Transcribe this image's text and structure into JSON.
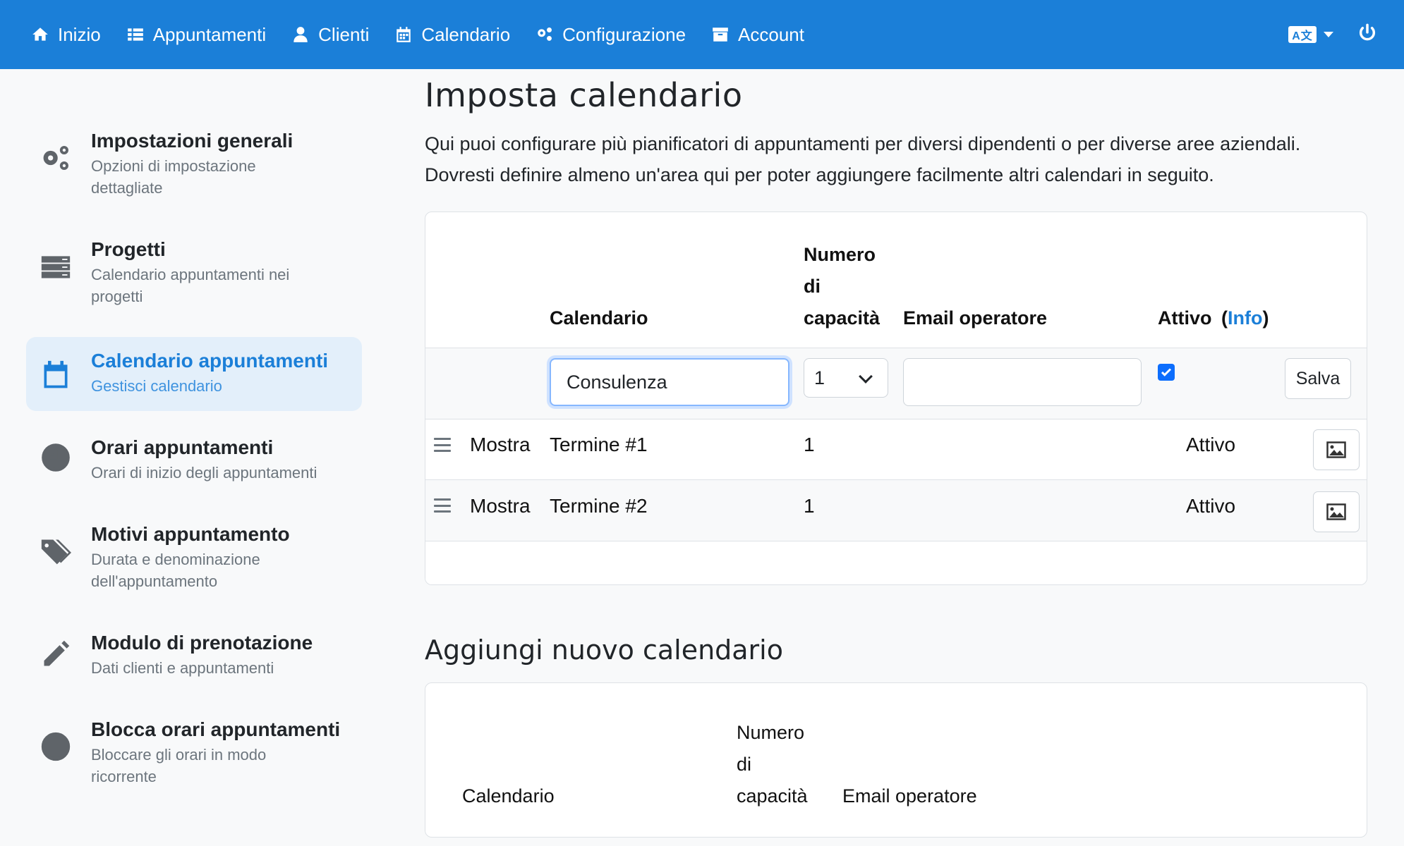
{
  "nav": {
    "items": [
      {
        "label": "Inizio",
        "icon": "home-icon"
      },
      {
        "label": "Appuntamenti",
        "icon": "list-icon"
      },
      {
        "label": "Clienti",
        "icon": "user-icon"
      },
      {
        "label": "Calendario",
        "icon": "calendar-icon"
      },
      {
        "label": "Configurazione",
        "icon": "gears-icon"
      },
      {
        "label": "Account",
        "icon": "archive-icon"
      }
    ],
    "language_icon": "language-icon",
    "power_icon": "power-icon",
    "background_color": "#1b7fd8"
  },
  "sidebar": {
    "items": [
      {
        "title": "Impostazioni generali",
        "subtitle": "Opzioni di impostazione dettagliate",
        "icon": "gears-icon"
      },
      {
        "title": "Progetti",
        "subtitle": "Calendario appuntamenti nei progetti",
        "icon": "server-icon"
      },
      {
        "title": "Calendario appuntamenti",
        "subtitle": "Gestisci calendario",
        "icon": "calendar-icon",
        "active": true
      },
      {
        "title": "Orari appuntamenti",
        "subtitle": "Orari di inizio degli appuntamenti",
        "icon": "clock-icon"
      },
      {
        "title": "Motivi appuntamento",
        "subtitle": "Durata e denominazione dell'appuntamento",
        "icon": "tags-icon"
      },
      {
        "title": "Modulo di prenotazione",
        "subtitle": "Dati clienti e appuntamenti",
        "icon": "pencil-icon"
      },
      {
        "title": "Blocca orari appuntamenti",
        "subtitle": "Bloccare gli orari in modo ricorrente",
        "icon": "ban-icon"
      }
    ]
  },
  "main": {
    "title": "Imposta calendario",
    "intro": "Qui puoi configurare più pianificatori di appuntamenti per diversi dipendenti o per diverse aree aziendali. Dovresti definire almeno un'area qui per poter aggiungere facilmente altri calendari in seguito.",
    "table": {
      "headers": {
        "calendar": "Calendario",
        "capacity_lines": [
          "Numero",
          "di",
          "capacità"
        ],
        "email": "Email operatore",
        "active": "Attivo",
        "active_open": "(",
        "active_info": "Info",
        "active_close": ")"
      },
      "edit_row": {
        "calendar_value": "Consulenza",
        "capacity_value": "1",
        "email_value": "",
        "active_checked": true,
        "save_label": "Salva"
      },
      "rows": [
        {
          "show_label": "Mostra",
          "name": "Termine #1",
          "capacity": "1",
          "status": "Attivo"
        },
        {
          "show_label": "Mostra",
          "name": "Termine #2",
          "capacity": "1",
          "status": "Attivo"
        }
      ]
    },
    "add_section": {
      "title": "Aggiungi nuovo calendario",
      "headers": {
        "calendar": "Calendario",
        "capacity_lines": [
          "Numero",
          "di",
          "capacità"
        ],
        "email": "Email operatore"
      }
    }
  }
}
